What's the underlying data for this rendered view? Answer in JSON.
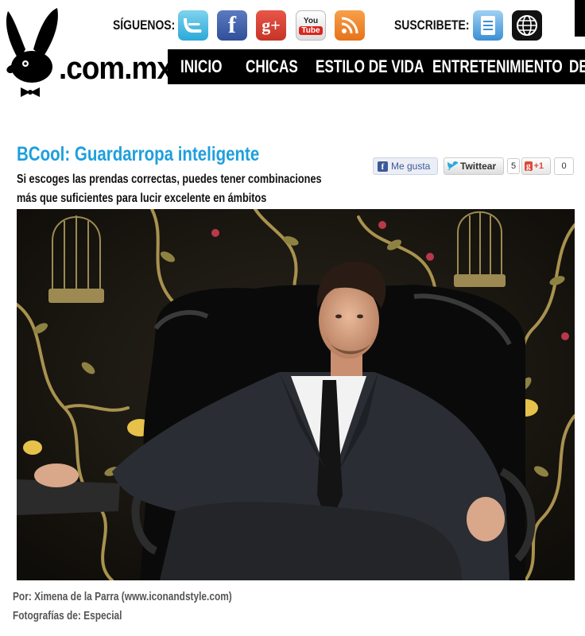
{
  "header": {
    "logo_text": ".com.mx",
    "follow_label": "SÍGUENOS:",
    "subscribe_label": "SUSCRIBETE:",
    "social_icons": [
      "twitter-icon",
      "facebook-icon",
      "google-plus-icon",
      "youtube-icon",
      "rss-icon"
    ],
    "subscribe_icons": [
      "newsletter-icon",
      "web-icon"
    ],
    "facebook_glyph": "f",
    "gplus_glyph": "g+",
    "youtube_top": "You",
    "youtube_bottom": "Tube"
  },
  "nav": {
    "items": [
      "INICIO",
      "CHICAS",
      "ESTILO DE VIDA",
      "ENTRETENIMIENTO",
      "DE"
    ]
  },
  "article": {
    "title": "BCool: Guardarropa inteligente",
    "subtitle": "Si escoges las prendas correctas, puedes tener combinaciones más que suficientes para lucir excelente en ámbitos profesionales y casuales...",
    "author_credit": "Por: Ximena de la Parra (www.iconandstyle.com)",
    "photo_credit": "Fotografías de: Especial"
  },
  "share": {
    "facebook_label": "Me gusta",
    "twitter_label": "Twittear",
    "twitter_count": "5",
    "gplus_label": "+1",
    "gplus_count": "0"
  },
  "colors": {
    "title_blue": "#1e9fdc",
    "nav_background": "#000000",
    "wallpaper": "#18150f",
    "vine_gold": "#a8924e"
  }
}
